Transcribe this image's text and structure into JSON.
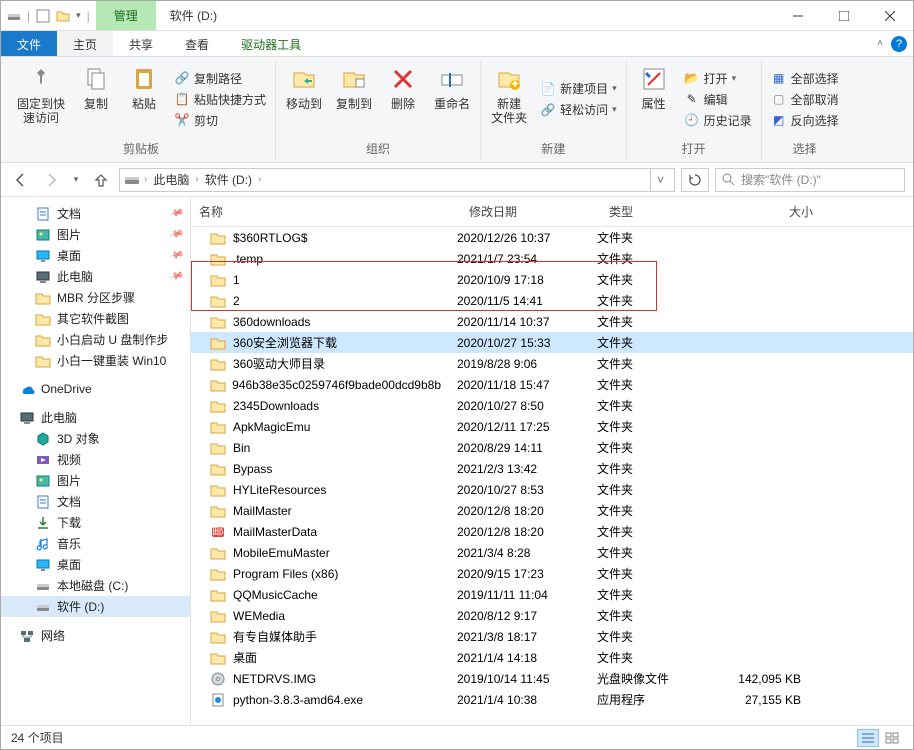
{
  "window": {
    "tab_manage": "管理",
    "tab_tools": "驱动器工具",
    "title": "软件 (D:)"
  },
  "tabs": {
    "file": "文件",
    "home": "主页",
    "share": "共享",
    "view": "查看"
  },
  "ribbon": {
    "pin": "固定到快\n速访问",
    "copy": "复制",
    "paste": "粘贴",
    "copy_path": "复制路径",
    "paste_shortcut": "粘贴快捷方式",
    "cut": "剪切",
    "group_clipboard": "剪贴板",
    "move_to": "移动到",
    "copy_to": "复制到",
    "delete": "删除",
    "rename": "重命名",
    "group_organize": "组织",
    "new_folder": "新建\n文件夹",
    "new_item": "新建项目",
    "easy_access": "轻松访问",
    "group_new": "新建",
    "properties": "属性",
    "open": "打开",
    "edit": "编辑",
    "history": "历史记录",
    "group_open": "打开",
    "select_all": "全部选择",
    "select_none": "全部取消",
    "invert": "反向选择",
    "group_select": "选择"
  },
  "breadcrumb": {
    "thispc": "此电脑",
    "drive": "软件 (D:)"
  },
  "search": {
    "placeholder": "搜索\"软件 (D:)\""
  },
  "navpane": [
    {
      "label": "文档",
      "icon": "doc",
      "pinned": true,
      "level": 2
    },
    {
      "label": "图片",
      "icon": "pic",
      "pinned": true,
      "level": 2
    },
    {
      "label": "桌面",
      "icon": "desktop",
      "pinned": true,
      "level": 2
    },
    {
      "label": "此电脑",
      "icon": "pc",
      "pinned": true,
      "level": 2
    },
    {
      "label": "MBR 分区步骤",
      "icon": "folder",
      "level": 2
    },
    {
      "label": "其它软件截图",
      "icon": "folder",
      "level": 2
    },
    {
      "label": "小白启动 U 盘制作步",
      "icon": "folder",
      "level": 2
    },
    {
      "label": "小白一键重装 Win10",
      "icon": "folder",
      "level": 2
    },
    {
      "spacer": true
    },
    {
      "label": "OneDrive",
      "icon": "onedrive",
      "level": 1
    },
    {
      "spacer": true
    },
    {
      "label": "此电脑",
      "icon": "pc",
      "level": 1
    },
    {
      "label": "3D 对象",
      "icon": "3d",
      "level": 2
    },
    {
      "label": "视频",
      "icon": "video",
      "level": 2
    },
    {
      "label": "图片",
      "icon": "pic",
      "level": 2
    },
    {
      "label": "文档",
      "icon": "doc",
      "level": 2
    },
    {
      "label": "下载",
      "icon": "download",
      "level": 2
    },
    {
      "label": "音乐",
      "icon": "music",
      "level": 2
    },
    {
      "label": "桌面",
      "icon": "desktop",
      "level": 2
    },
    {
      "label": "本地磁盘 (C:)",
      "icon": "drive",
      "level": 2
    },
    {
      "label": "软件 (D:)",
      "icon": "drive",
      "level": 2,
      "selected": true
    },
    {
      "spacer": true
    },
    {
      "label": "网络",
      "icon": "network",
      "level": 1
    }
  ],
  "columns": {
    "name": "名称",
    "date": "修改日期",
    "type": "类型",
    "size": "大小"
  },
  "files": [
    {
      "name": "$360RTLOG$",
      "date": "2020/12/26 10:37",
      "type": "文件夹",
      "icon": "folder"
    },
    {
      "name": ".temp",
      "date": "2021/1/7 23:54",
      "type": "文件夹",
      "icon": "folder"
    },
    {
      "name": "1",
      "date": "2020/10/9 17:18",
      "type": "文件夹",
      "icon": "folder"
    },
    {
      "name": "2",
      "date": "2020/11/5 14:41",
      "type": "文件夹",
      "icon": "folder"
    },
    {
      "name": "360downloads",
      "date": "2020/11/14 10:37",
      "type": "文件夹",
      "icon": "folder"
    },
    {
      "name": "360安全浏览器下载",
      "date": "2020/10/27 15:33",
      "type": "文件夹",
      "icon": "folder",
      "selected": true
    },
    {
      "name": "360驱动大师目录",
      "date": "2019/8/28 9:06",
      "type": "文件夹",
      "icon": "folder"
    },
    {
      "name": "946b38e35c0259746f9bade00dcd9b8b",
      "date": "2020/11/18 15:47",
      "type": "文件夹",
      "icon": "folder"
    },
    {
      "name": "2345Downloads",
      "date": "2020/10/27 8:50",
      "type": "文件夹",
      "icon": "folder"
    },
    {
      "name": "ApkMagicEmu",
      "date": "2020/12/11 17:25",
      "type": "文件夹",
      "icon": "folder"
    },
    {
      "name": "Bin",
      "date": "2020/8/29 14:11",
      "type": "文件夹",
      "icon": "folder"
    },
    {
      "name": "Bypass",
      "date": "2021/2/3 13:42",
      "type": "文件夹",
      "icon": "folder"
    },
    {
      "name": "HYLiteResources",
      "date": "2020/10/27 8:53",
      "type": "文件夹",
      "icon": "folder"
    },
    {
      "name": "MailMaster",
      "date": "2020/12/8 18:20",
      "type": "文件夹",
      "icon": "folder"
    },
    {
      "name": "MailMasterData",
      "date": "2020/12/8 18:20",
      "type": "文件夹",
      "icon": "mail"
    },
    {
      "name": "MobileEmuMaster",
      "date": "2021/3/4 8:28",
      "type": "文件夹",
      "icon": "folder"
    },
    {
      "name": "Program Files (x86)",
      "date": "2020/9/15 17:23",
      "type": "文件夹",
      "icon": "folder"
    },
    {
      "name": "QQMusicCache",
      "date": "2019/11/11 11:04",
      "type": "文件夹",
      "icon": "folder"
    },
    {
      "name": "WEMedia",
      "date": "2020/8/12 9:17",
      "type": "文件夹",
      "icon": "folder"
    },
    {
      "name": "有专自媒体助手",
      "date": "2021/3/8 18:17",
      "type": "文件夹",
      "icon": "folder"
    },
    {
      "name": "桌面",
      "date": "2021/1/4 14:18",
      "type": "文件夹",
      "icon": "folder"
    },
    {
      "name": "NETDRVS.IMG",
      "date": "2019/10/14 11:45",
      "type": "光盘映像文件",
      "size": "142,095 KB",
      "icon": "disc"
    },
    {
      "name": "python-3.8.3-amd64.exe",
      "date": "2021/1/4 10:38",
      "type": "应用程序",
      "size": "27,155 KB",
      "icon": "exe"
    }
  ],
  "status": {
    "items": "24 个项目"
  }
}
